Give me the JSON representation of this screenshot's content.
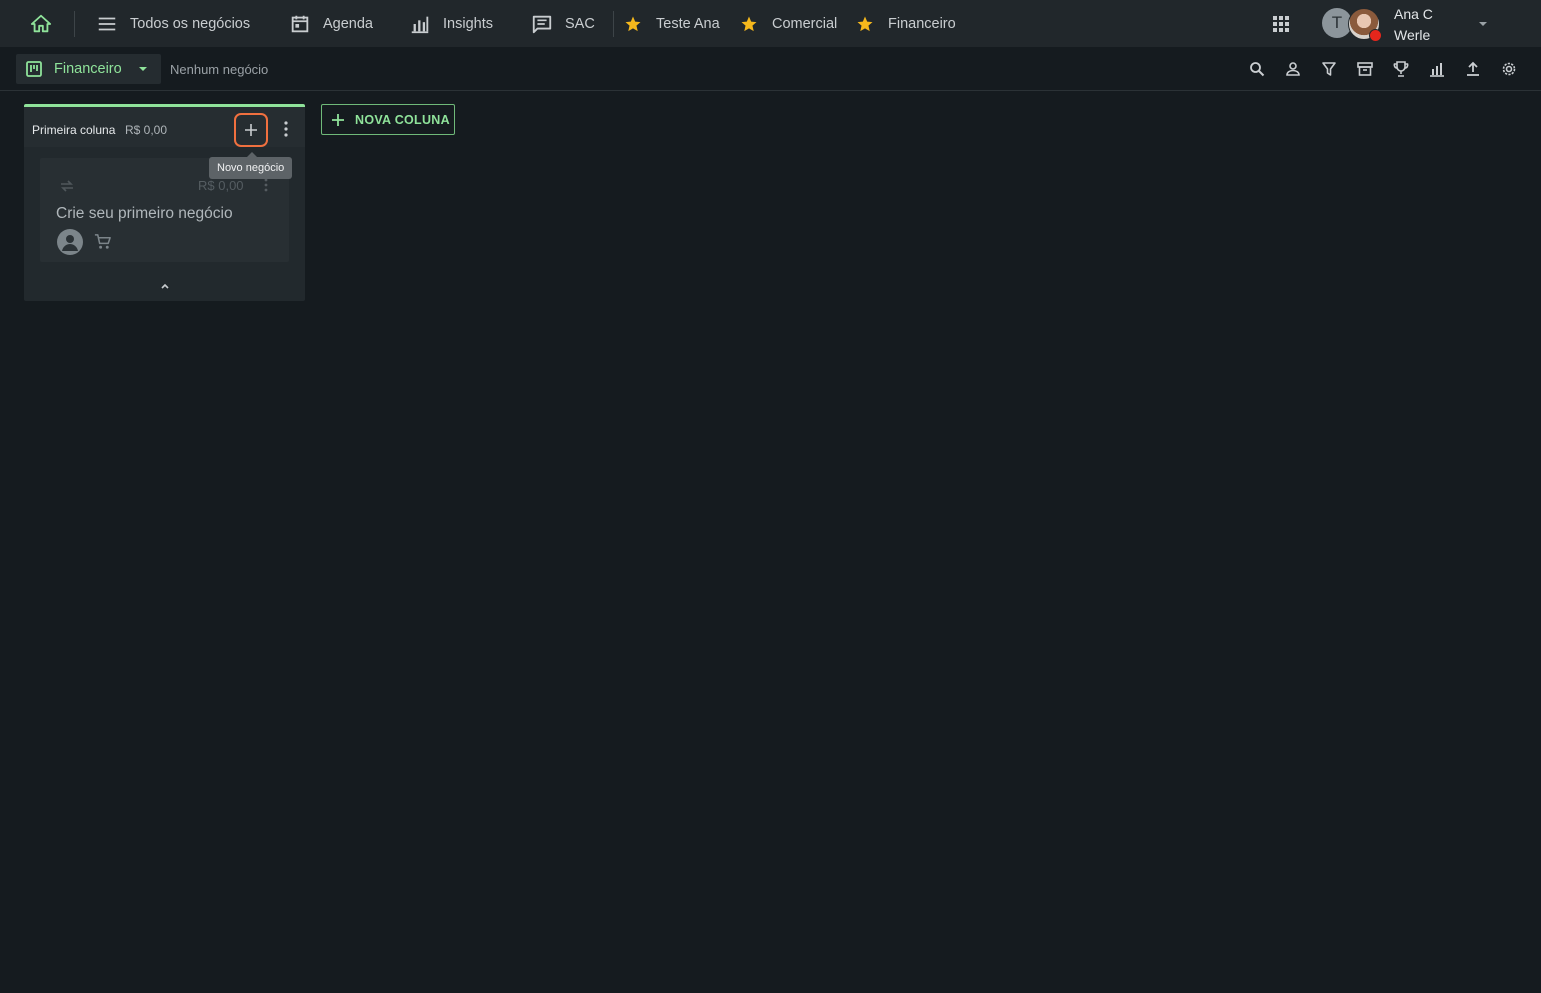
{
  "topnav": {
    "items": [
      {
        "label": "Todos os negócios",
        "icon": "list-icon"
      },
      {
        "label": "Agenda",
        "icon": "calendar-icon"
      },
      {
        "label": "Insights",
        "icon": "bar-chart-icon"
      },
      {
        "label": "SAC",
        "icon": "message-icon"
      }
    ],
    "favorites": [
      {
        "label": "Teste Ana",
        "icon": "star-icon"
      },
      {
        "label": "Comercial",
        "icon": "star-icon"
      },
      {
        "label": "Financeiro",
        "icon": "star-icon"
      }
    ],
    "user": {
      "initial": "T",
      "name": "Ana C Werle",
      "status_color": "#e5261c"
    }
  },
  "subbar": {
    "pipeline": "Financeiro",
    "deal_status": "Nenhum negócio",
    "tools": [
      "search-icon",
      "person-icon",
      "filter-icon",
      "archive-icon",
      "trophy-icon",
      "chart-icon",
      "upload-icon",
      "settings-icon"
    ]
  },
  "board": {
    "columns": [
      {
        "title": "Primeira coluna",
        "total": "R$ 0,00",
        "accent": "#8fe39a",
        "add_tooltip": "Novo negócio",
        "placeholder_card": {
          "value": "R$ 0,00",
          "title": "Crie seu primeiro negócio"
        }
      }
    ],
    "new_column_label": "NOVA COLUNA"
  },
  "colors": {
    "background": "#151b1f",
    "topbar": "#21272b",
    "accent": "#8fe39a",
    "favorite_star": "#f5b81c",
    "highlight": "#f0703f"
  }
}
